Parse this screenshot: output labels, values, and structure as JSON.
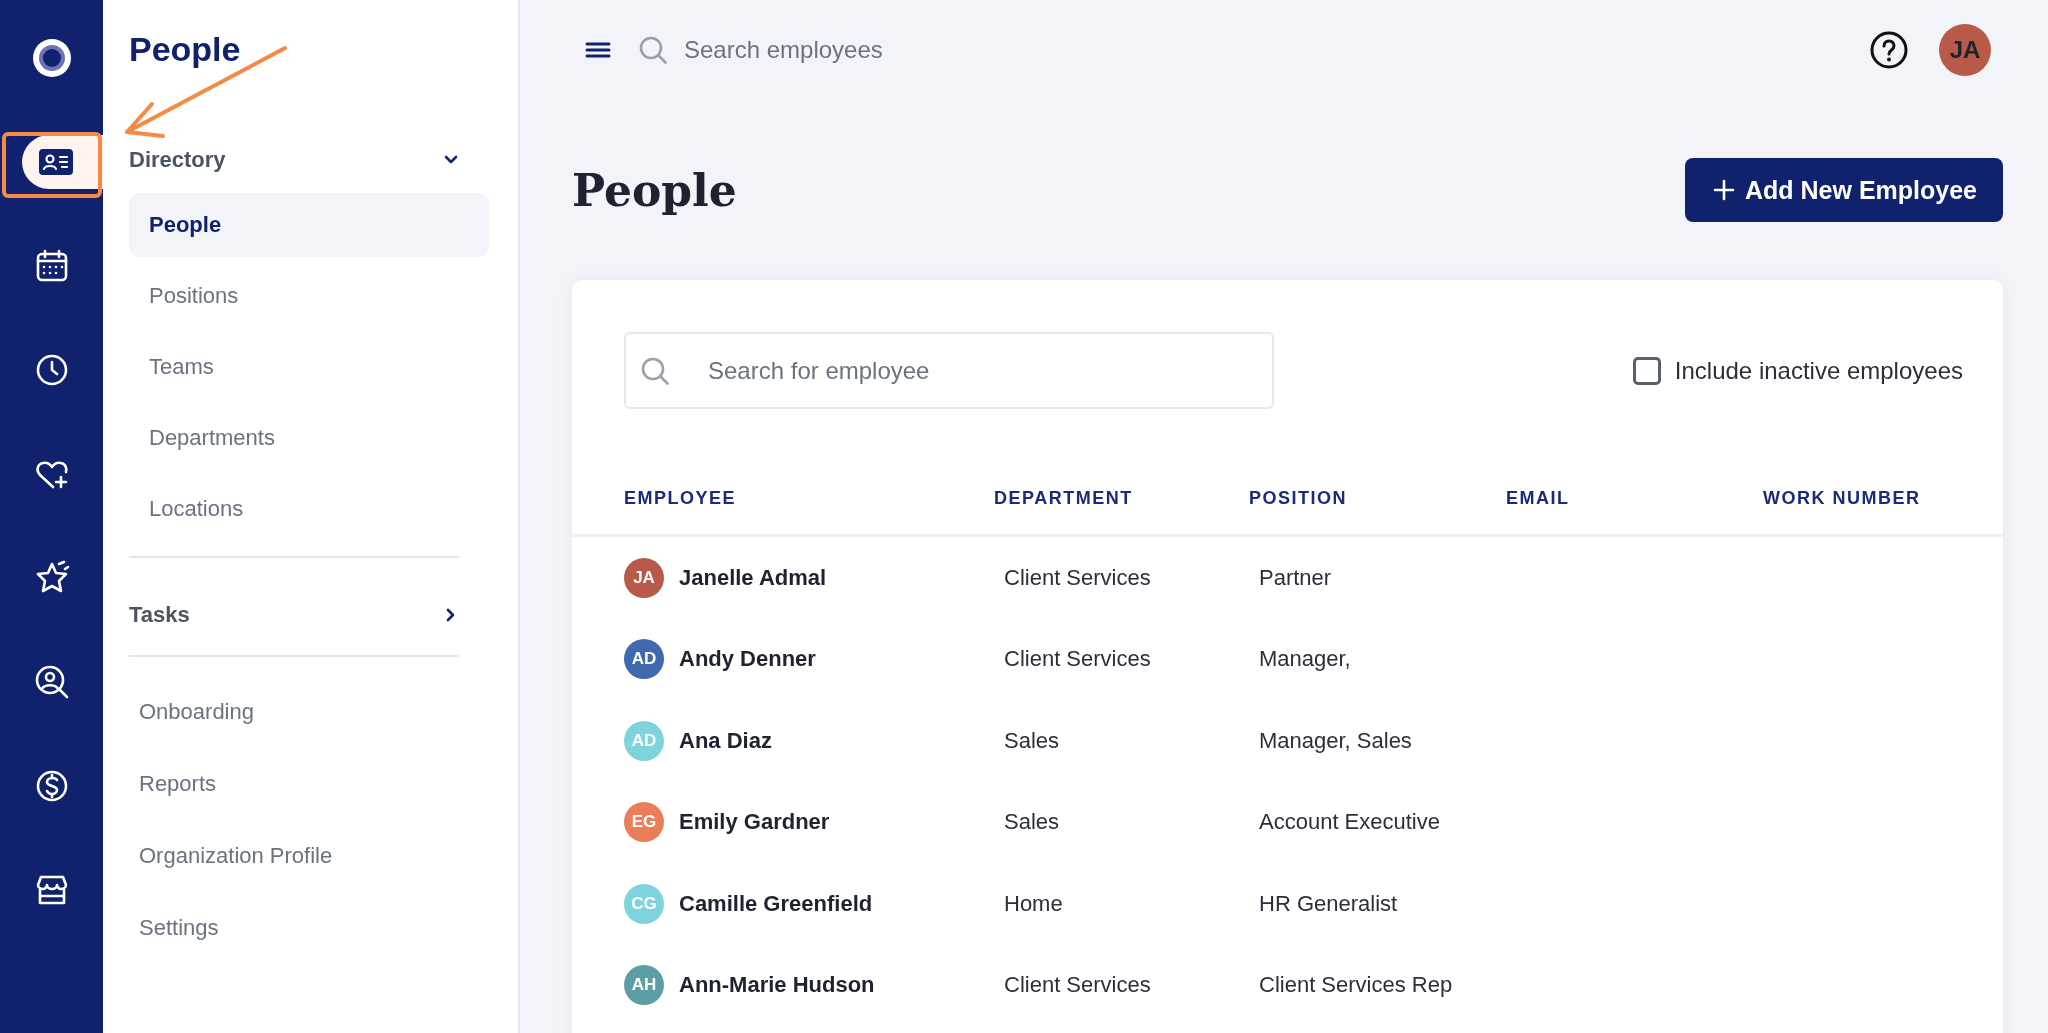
{
  "rail": {
    "items": [
      {
        "selected": false
      },
      {
        "selected": true
      },
      {
        "selected": false
      },
      {
        "selected": false
      },
      {
        "selected": false
      },
      {
        "selected": false
      },
      {
        "selected": false
      },
      {
        "selected": false
      },
      {
        "selected": false
      }
    ]
  },
  "sidebar": {
    "title": "People",
    "sections": [
      {
        "label": "Directory",
        "expanded": true,
        "children": [
          {
            "label": "People",
            "selected": true
          },
          {
            "label": "Positions",
            "selected": false
          },
          {
            "label": "Teams",
            "selected": false
          },
          {
            "label": "Departments",
            "selected": false
          },
          {
            "label": "Locations",
            "selected": false
          }
        ]
      },
      {
        "label": "Tasks",
        "expanded": false
      }
    ],
    "links": [
      {
        "label": "Onboarding",
        "selected": false
      },
      {
        "label": "Reports",
        "selected": false
      },
      {
        "label": "Organization Profile",
        "selected": false
      },
      {
        "label": "Settings",
        "selected": false
      }
    ]
  },
  "top_bar": {
    "search": {
      "placeholder": "Search employees"
    },
    "user_avatar": {
      "initials": "JA",
      "color": "#b85a4a"
    }
  },
  "page": {
    "title": "People",
    "add_button": "Add New Employee",
    "search": {
      "placeholder": "Search for employee"
    },
    "include_inactive": {
      "label": "Include inactive employees",
      "checked": false
    },
    "table": {
      "columns": [
        "EMPLOYEE",
        "DEPARTMENT",
        "POSITION",
        "EMAIL",
        "WORK NUMBER"
      ],
      "rows": [
        {
          "initials": "JA",
          "color": "#b85a4a",
          "name": "Janelle Admal",
          "department": "Client Services",
          "position": "Partner"
        },
        {
          "initials": "AD",
          "color": "#3f6ab0",
          "name": "Andy Denner",
          "department": "Client Services",
          "position": "Manager,"
        },
        {
          "initials": "AD",
          "color": "#7fd3dc",
          "name": "Ana Diaz",
          "department": "Sales",
          "position": "Manager, Sales"
        },
        {
          "initials": "EG",
          "color": "#eb7d5b",
          "name": "Emily Gardner",
          "department": "Sales",
          "position": "Account Executive"
        },
        {
          "initials": "CG",
          "color": "#7fd3dc",
          "name": "Camille Greenfield",
          "department": "Home",
          "position": "HR Generalist"
        },
        {
          "initials": "AH",
          "color": "#5c9ea3",
          "name": "Ann-Marie Hudson",
          "department": "Client Services",
          "position": "Client Services Rep"
        }
      ]
    }
  }
}
